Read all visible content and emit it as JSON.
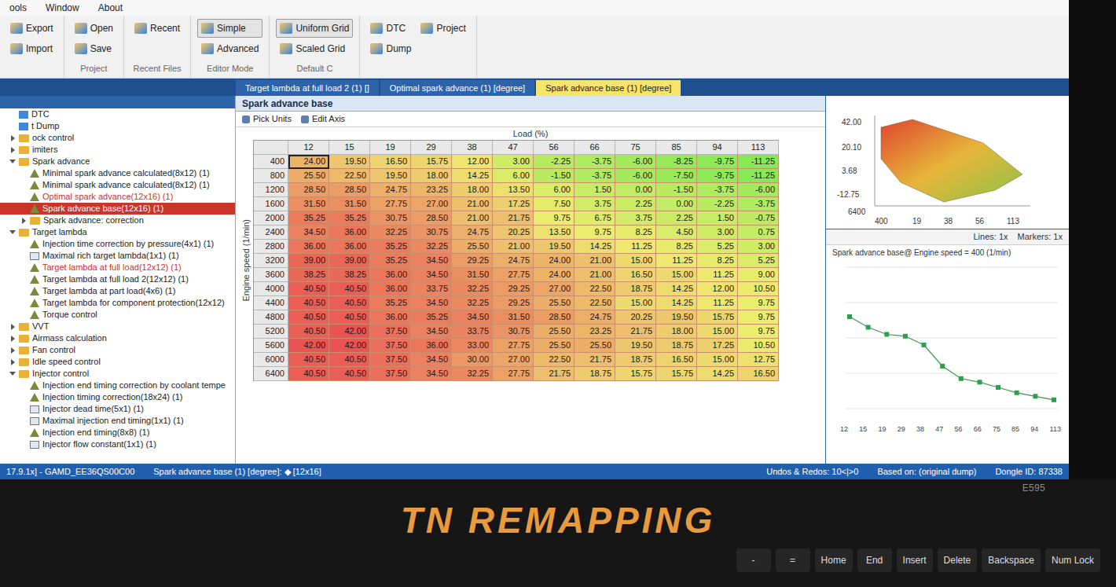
{
  "window": {
    "menu": [
      "ools",
      "Window",
      "About"
    ]
  },
  "ribbon": {
    "groups": [
      {
        "title": "",
        "buttons": [
          {
            "label": "Export",
            "selected": false
          },
          {
            "label": "Import",
            "selected": false
          }
        ]
      },
      {
        "title": "Project",
        "buttons": [
          {
            "label": "Open",
            "selected": false
          },
          {
            "label": "Save",
            "selected": false
          }
        ]
      },
      {
        "title": "Recent Files",
        "buttons": [
          {
            "label": "Recent",
            "selected": false
          }
        ]
      },
      {
        "title": "Editor Mode",
        "buttons": [
          {
            "label": "Simple",
            "selected": true
          },
          {
            "label": "Advanced",
            "selected": false
          }
        ]
      },
      {
        "title": "Default C",
        "buttons": [
          {
            "label": "Uniform Grid",
            "selected": true
          },
          {
            "label": "Scaled Grid",
            "selected": false
          }
        ]
      },
      {
        "title": "",
        "buttons": [
          {
            "label": "DTC",
            "selected": false
          },
          {
            "label": "Dump",
            "selected": false
          },
          {
            "label": "Project",
            "selected": false
          }
        ]
      }
    ]
  },
  "tabs": [
    {
      "label": "Target lambda at full load 2 (1) []",
      "selected": false
    },
    {
      "label": "Optimal spark advance (1) [degree]",
      "selected": false
    },
    {
      "label": "Spark advance base (1) [degree]",
      "selected": true
    }
  ],
  "tree": {
    "items": [
      {
        "label": "DTC",
        "kind": "item",
        "depth": 0,
        "modified": false,
        "selected": false,
        "expanded": false
      },
      {
        "label": "t Dump",
        "kind": "item",
        "depth": 0,
        "modified": false,
        "selected": false,
        "expanded": false
      },
      {
        "label": "ock control",
        "kind": "folder",
        "depth": 0,
        "modified": false,
        "selected": false,
        "expanded": false
      },
      {
        "label": "imiters",
        "kind": "folder",
        "depth": 0,
        "modified": false,
        "selected": false,
        "expanded": false
      },
      {
        "label": "Spark advance",
        "kind": "folder",
        "depth": 0,
        "modified": false,
        "selected": false,
        "expanded": true
      },
      {
        "label": "Minimal spark advance calculated(8x12) (1)",
        "kind": "map",
        "depth": 1,
        "modified": false,
        "selected": false,
        "expanded": false
      },
      {
        "label": "Minimal spark advance calculated(8x12) (1)",
        "kind": "map",
        "depth": 1,
        "modified": false,
        "selected": false,
        "expanded": false
      },
      {
        "label": "Optimal spark advance(12x16) (1)",
        "kind": "map",
        "depth": 1,
        "modified": true,
        "selected": false,
        "expanded": false
      },
      {
        "label": "Spark advance base(12x16) (1)",
        "kind": "map",
        "depth": 1,
        "modified": true,
        "selected": true,
        "expanded": false
      },
      {
        "label": "Spark advance: correction",
        "kind": "folder",
        "depth": 1,
        "modified": false,
        "selected": false,
        "expanded": false
      },
      {
        "label": "Target lambda",
        "kind": "folder",
        "depth": 0,
        "modified": false,
        "selected": false,
        "expanded": true
      },
      {
        "label": "Injection time correction by pressure(4x1) (1)",
        "kind": "map",
        "depth": 1,
        "modified": false,
        "selected": false,
        "expanded": false
      },
      {
        "label": "Maximal rich target lambda(1x1) (1)",
        "kind": "value",
        "depth": 1,
        "modified": false,
        "selected": false,
        "expanded": false
      },
      {
        "label": "Target lambda at full load(12x12) (1)",
        "kind": "map",
        "depth": 1,
        "modified": true,
        "selected": false,
        "expanded": false
      },
      {
        "label": "Target lambda at full load 2(12x12) (1)",
        "kind": "map",
        "depth": 1,
        "modified": false,
        "selected": false,
        "expanded": false
      },
      {
        "label": "Target lambda at part load(4x6) (1)",
        "kind": "map",
        "depth": 1,
        "modified": false,
        "selected": false,
        "expanded": false
      },
      {
        "label": "Target lambda for component protection(12x12)",
        "kind": "map",
        "depth": 1,
        "modified": false,
        "selected": false,
        "expanded": false
      },
      {
        "label": "Torque control",
        "kind": "map",
        "depth": 1,
        "modified": false,
        "selected": false,
        "expanded": false
      },
      {
        "label": "VVT",
        "kind": "folder",
        "depth": 0,
        "modified": false,
        "selected": false,
        "expanded": false
      },
      {
        "label": "Airmass calculation",
        "kind": "folder",
        "depth": 0,
        "modified": false,
        "selected": false,
        "expanded": false
      },
      {
        "label": "Fan control",
        "kind": "folder",
        "depth": 0,
        "modified": false,
        "selected": false,
        "expanded": false
      },
      {
        "label": "Idle speed control",
        "kind": "folder",
        "depth": 0,
        "modified": false,
        "selected": false,
        "expanded": false
      },
      {
        "label": "Injector control",
        "kind": "folder",
        "depth": 0,
        "modified": false,
        "selected": false,
        "expanded": true
      },
      {
        "label": "Injection end timing correction by coolant tempe",
        "kind": "map",
        "depth": 1,
        "modified": false,
        "selected": false,
        "expanded": false
      },
      {
        "label": "Injection timing correction(18x24) (1)",
        "kind": "map",
        "depth": 1,
        "modified": false,
        "selected": false,
        "expanded": false
      },
      {
        "label": "Injector dead time(5x1) (1)",
        "kind": "value",
        "depth": 1,
        "modified": false,
        "selected": false,
        "expanded": false
      },
      {
        "label": "Maximal injection end timing(1x1) (1)",
        "kind": "value",
        "depth": 1,
        "modified": false,
        "selected": false,
        "expanded": false
      },
      {
        "label": "Injection end timing(8x8) (1)",
        "kind": "map",
        "depth": 1,
        "modified": false,
        "selected": false,
        "expanded": false
      },
      {
        "label": "Injector flow constant(1x1) (1)",
        "kind": "value",
        "depth": 1,
        "modified": false,
        "selected": false,
        "expanded": false
      }
    ]
  },
  "editor": {
    "title": "Spark advance base",
    "tools": [
      "Pick Units",
      "Edit Axis"
    ],
    "x_axis": "Load (%)",
    "y_axis": "Engine speed (1/min)"
  },
  "table": {
    "columns": [
      "12",
      "15",
      "19",
      "29",
      "38",
      "47",
      "56",
      "66",
      "75",
      "85",
      "94",
      "113"
    ],
    "selection": {
      "row": 0,
      "col": 0
    },
    "rows": [
      {
        "label": "400",
        "cells": [
          "24.00",
          "19.50",
          "16.50",
          "15.75",
          "12.00",
          "3.00",
          "-2.25",
          "-3.75",
          "-6.00",
          "-8.25",
          "-9.75",
          "-11.25"
        ]
      },
      {
        "label": "800",
        "cells": [
          "25.50",
          "22.50",
          "19.50",
          "18.00",
          "14.25",
          "6.00",
          "-1.50",
          "-3.75",
          "-6.00",
          "-7.50",
          "-9.75",
          "-11.25"
        ]
      },
      {
        "label": "1200",
        "cells": [
          "28.50",
          "28.50",
          "24.75",
          "23.25",
          "18.00",
          "13.50",
          "6.00",
          "1.50",
          "0.00",
          "-1.50",
          "-3.75",
          "-6.00"
        ]
      },
      {
        "label": "1600",
        "cells": [
          "31.50",
          "31.50",
          "27.75",
          "27.00",
          "21.00",
          "17.25",
          "7.50",
          "3.75",
          "2.25",
          "0.00",
          "-2.25",
          "-3.75"
        ]
      },
      {
        "label": "2000",
        "cells": [
          "35.25",
          "35.25",
          "30.75",
          "28.50",
          "21.00",
          "21.75",
          "9.75",
          "6.75",
          "3.75",
          "2.25",
          "1.50",
          "-0.75"
        ]
      },
      {
        "label": "2400",
        "cells": [
          "34.50",
          "36.00",
          "32.25",
          "30.75",
          "24.75",
          "20.25",
          "13.50",
          "9.75",
          "8.25",
          "4.50",
          "3.00",
          "0.75"
        ]
      },
      {
        "label": "2800",
        "cells": [
          "36.00",
          "36.00",
          "35.25",
          "32.25",
          "25.50",
          "21.00",
          "19.50",
          "14.25",
          "11.25",
          "8.25",
          "5.25",
          "3.00"
        ]
      },
      {
        "label": "3200",
        "cells": [
          "39.00",
          "39.00",
          "35.25",
          "34.50",
          "29.25",
          "24.75",
          "24.00",
          "21.00",
          "15.00",
          "11.25",
          "8.25",
          "5.25"
        ]
      },
      {
        "label": "3600",
        "cells": [
          "38.25",
          "38.25",
          "36.00",
          "34.50",
          "31.50",
          "27.75",
          "24.00",
          "21.00",
          "16.50",
          "15.00",
          "11.25",
          "9.00"
        ]
      },
      {
        "label": "4000",
        "cells": [
          "40.50",
          "40.50",
          "36.00",
          "33.75",
          "32.25",
          "29.25",
          "27.00",
          "22.50",
          "18.75",
          "14.25",
          "12.00",
          "10.50"
        ]
      },
      {
        "label": "4400",
        "cells": [
          "40.50",
          "40.50",
          "35.25",
          "34.50",
          "32.25",
          "29.25",
          "25.50",
          "22.50",
          "15.00",
          "14.25",
          "11.25",
          "9.75"
        ]
      },
      {
        "label": "4800",
        "cells": [
          "40.50",
          "40.50",
          "36.00",
          "35.25",
          "34.50",
          "31.50",
          "28.50",
          "24.75",
          "20.25",
          "19.50",
          "15.75",
          "9.75"
        ]
      },
      {
        "label": "5200",
        "cells": [
          "40.50",
          "42.00",
          "37.50",
          "34.50",
          "33.75",
          "30.75",
          "25.50",
          "23.25",
          "21.75",
          "18.00",
          "15.00",
          "9.75"
        ]
      },
      {
        "label": "5600",
        "cells": [
          "42.00",
          "42.00",
          "37.50",
          "36.00",
          "33.00",
          "27.75",
          "25.50",
          "25.50",
          "19.50",
          "18.75",
          "17.25",
          "10.50"
        ]
      },
      {
        "label": "6000",
        "cells": [
          "40.50",
          "40.50",
          "37.50",
          "34.50",
          "30.00",
          "27.00",
          "22.50",
          "21.75",
          "18.75",
          "16.50",
          "15.00",
          "12.75"
        ]
      },
      {
        "label": "6400",
        "cells": [
          "40.50",
          "40.50",
          "37.50",
          "34.50",
          "32.25",
          "27.75",
          "21.75",
          "18.75",
          "15.75",
          "15.75",
          "14.25",
          "16.50"
        ]
      }
    ]
  },
  "surface": {
    "z_ticks": [
      "42.00",
      "20.10",
      "3.68",
      "-12.75"
    ],
    "y_ticks": [
      "6400",
      "400"
    ],
    "x_ticks": [
      "19",
      "38",
      "56",
      "113"
    ]
  },
  "graph": {
    "title": "Spark advance base@ Engine speed = 400 (1/min)",
    "controls": [
      "Lines: 1x",
      "Markers: 1x"
    ],
    "x_labels": [
      "12",
      "15",
      "19",
      "29",
      "38",
      "47",
      "56",
      "66",
      "75",
      "85",
      "94",
      "113"
    ],
    "series": [
      24.0,
      19.5,
      16.5,
      15.75,
      12.0,
      3.0,
      -2.25,
      -3.75,
      -6.0,
      -8.25,
      -9.75,
      -11.25
    ]
  },
  "status_bar": {
    "left": [
      "17.9.1x] - GAMD_EE36QS00C00",
      "Spark advance base (1) [degree]: ◆ [12x16]"
    ],
    "right": [
      "Undos & Redos: 10<|>0",
      "Based on: (original dump)",
      "Dongle ID: 87338"
    ]
  },
  "laptop": {
    "model": "E595",
    "brand": "TN REMAPPING",
    "keys": [
      "-",
      "=",
      "Home",
      "End",
      "Insert",
      "Delete",
      "Backspace",
      "Num Lock"
    ]
  }
}
